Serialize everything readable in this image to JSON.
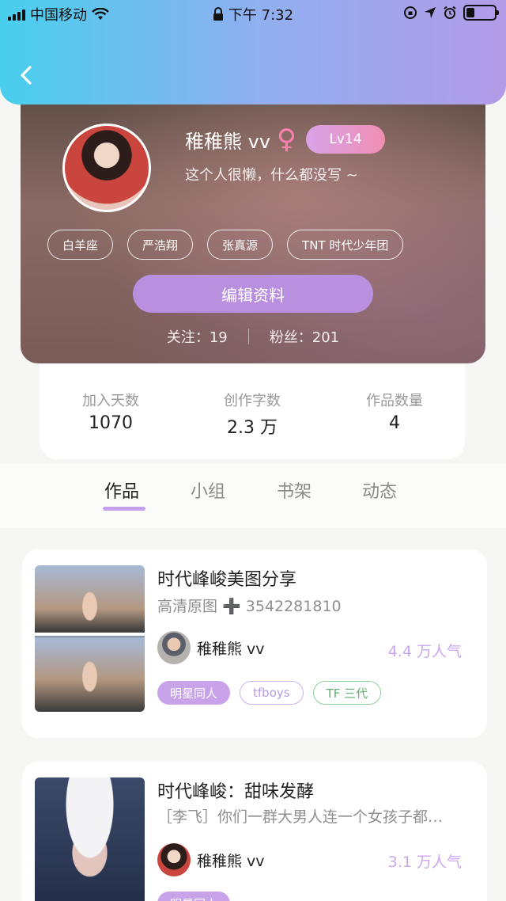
{
  "status_bar": {
    "carrier": "中国移动",
    "time": "下午 7:32"
  },
  "profile": {
    "username": "稚稚熊 vv",
    "gender_icon": "female-icon",
    "level": "Lv14",
    "bio": "这个人很懒，什么都没写 ~",
    "tags": [
      "白羊座",
      "严浩翔",
      "张真源",
      "TNT 时代少年团"
    ],
    "edit_button": "编辑资料",
    "following_label": "关注：19",
    "followers_label": "粉丝：201"
  },
  "stats": [
    {
      "label": "加入天数",
      "value": "1070"
    },
    {
      "label": "创作字数",
      "value": "2.3 万"
    },
    {
      "label": "作品数量",
      "value": "4"
    }
  ],
  "tabs": [
    "作品",
    "小组",
    "书架",
    "动态"
  ],
  "active_tab": "作品",
  "works": [
    {
      "title": "时代峰峻美图分享",
      "subtitle": "高清原图 ➕ 3542281810",
      "author": "稚稚熊 vv",
      "popularity": "4.4 万人气",
      "tags": [
        "明星同人",
        "tfboys",
        "TF 三代"
      ]
    },
    {
      "title": "时代峰峻：甜味发酵",
      "subtitle": "［李飞］你们一群大男人连一个女孩子都…",
      "author": "稚稚熊 vv",
      "popularity": "3.1 万人气",
      "tags": [
        "明星同人"
      ]
    }
  ],
  "colors": {
    "header_gradient_start": "#48cfee",
    "header_gradient_end": "#b39be8",
    "accent_purple": "#b990e0",
    "popularity_text": "#cba7ec",
    "gender_pink": "#ff7fb0"
  }
}
